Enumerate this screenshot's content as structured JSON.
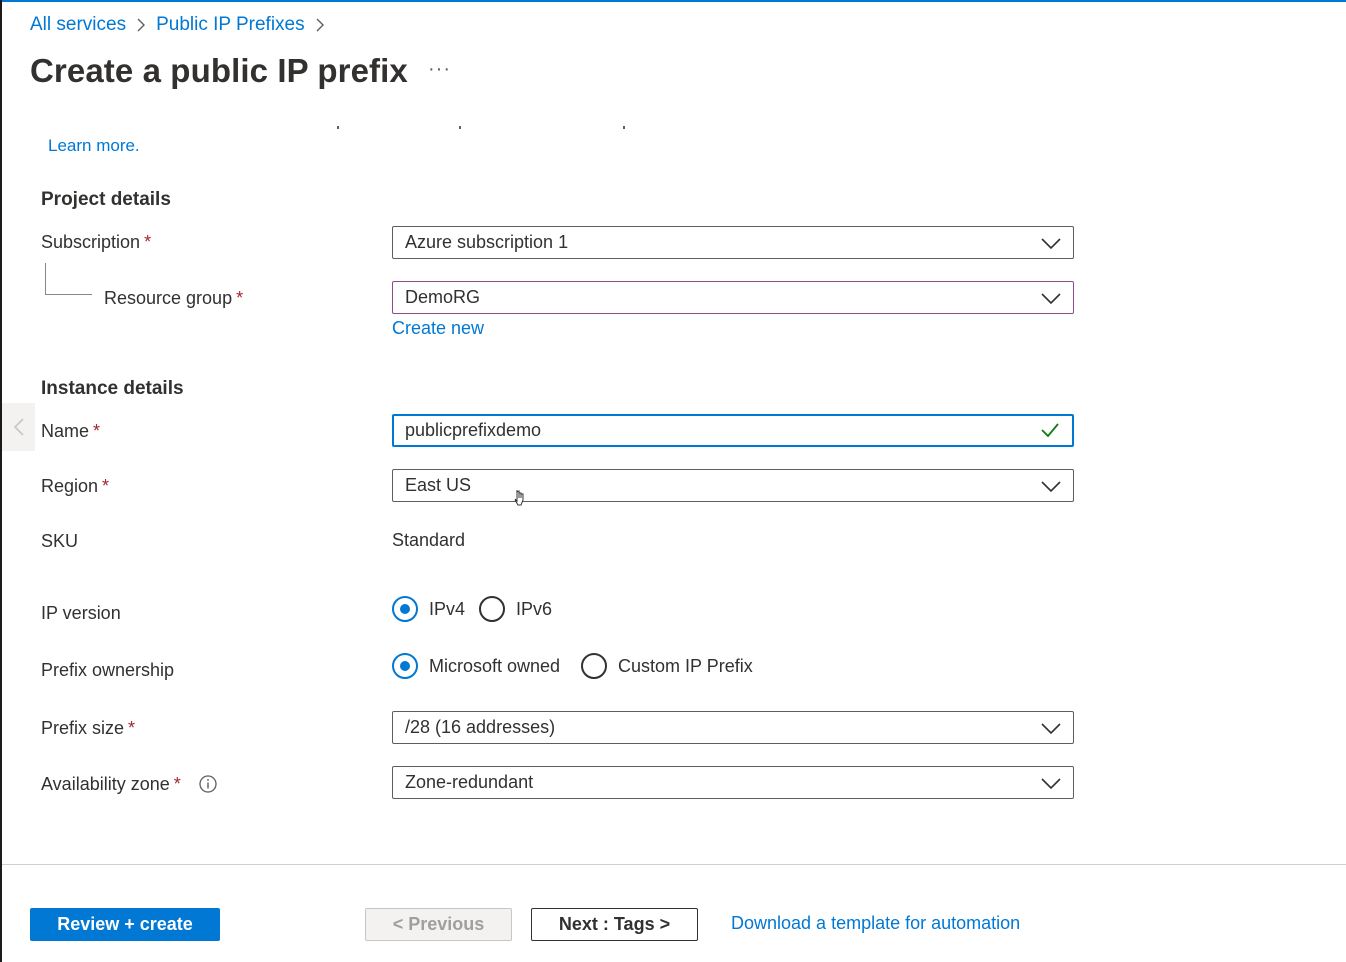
{
  "breadcrumb": {
    "items": [
      "All services",
      "Public IP Prefixes"
    ]
  },
  "page": {
    "title": "Create a public IP prefix",
    "more_label": "···"
  },
  "intro": {
    "learn_more": "Learn more."
  },
  "project_details": {
    "heading": "Project details",
    "subscription": {
      "label": "Subscription",
      "required_mark": "*",
      "value": "Azure subscription 1"
    },
    "resource_group": {
      "label": "Resource group",
      "required_mark": "*",
      "value": "DemoRG",
      "create_new": "Create new"
    }
  },
  "instance_details": {
    "heading": "Instance details",
    "name": {
      "label": "Name",
      "required_mark": "*",
      "value": "publicprefixdemo"
    },
    "region": {
      "label": "Region",
      "required_mark": "*",
      "value": "East US"
    },
    "sku": {
      "label": "SKU",
      "value": "Standard"
    },
    "ip_version": {
      "label": "IP version",
      "options": [
        "IPv4",
        "IPv6"
      ],
      "selected": "IPv4"
    },
    "prefix_ownership": {
      "label": "Prefix ownership",
      "options": [
        "Microsoft owned",
        "Custom IP Prefix"
      ],
      "selected": "Microsoft owned"
    },
    "prefix_size": {
      "label": "Prefix size",
      "required_mark": "*",
      "value": "/28 (16 addresses)"
    },
    "availability_zone": {
      "label": "Availability zone",
      "required_mark": "*",
      "value": "Zone-redundant"
    }
  },
  "footer": {
    "review_create": "Review + create",
    "previous": "< Previous",
    "next": "Next : Tags >",
    "download_template": "Download a template for automation"
  },
  "colors": {
    "accent": "#0078d4",
    "required": "#a4262c",
    "valid_check": "#107c10",
    "resource_group_border": "#8c4d8f"
  },
  "icons": {
    "breadcrumb_separator": "chevron-right-icon",
    "dropdown": "chevron-down-icon",
    "valid": "checkmark-icon",
    "info": "info-icon",
    "collapse": "chevron-left-icon"
  }
}
